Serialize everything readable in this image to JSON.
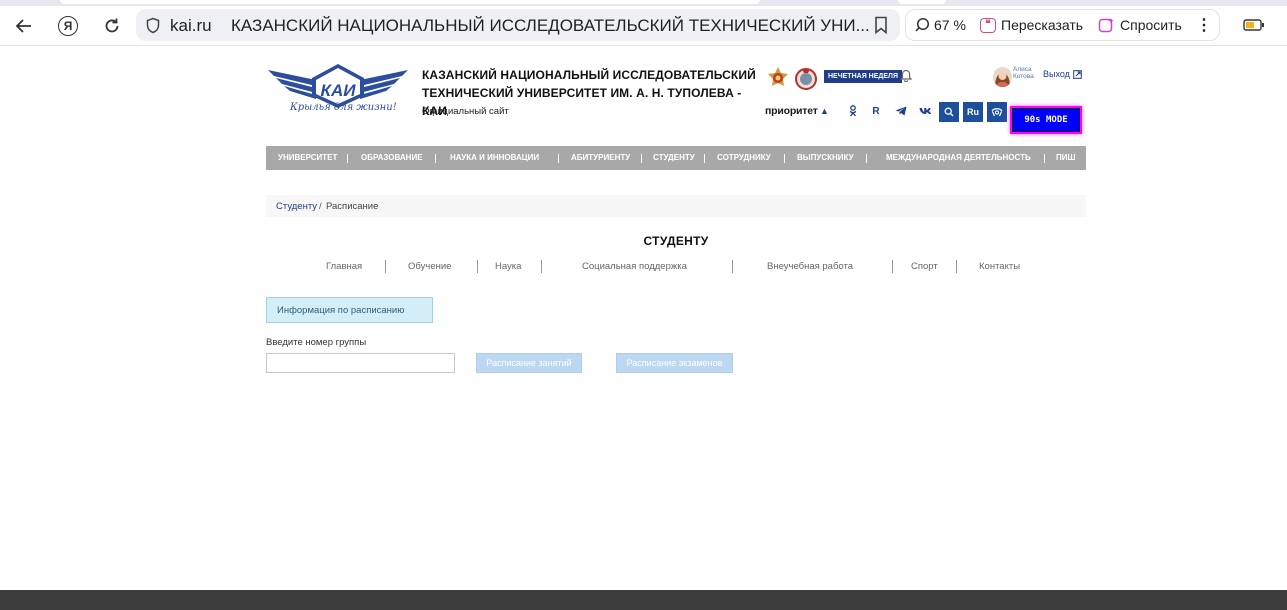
{
  "browser": {
    "domain": "kai.ru",
    "page_title": "КАЗАНСКИЙ НАЦИОНАЛЬНЫЙ ИССЛЕДОВАТЕЛЬСКИЙ ТЕХНИЧЕСКИЙ УНИ...",
    "zoom": "67 %",
    "retell_label": "Пересказать",
    "ask_label": "Спросить",
    "yandex_glyph": "Я"
  },
  "header": {
    "logo_letters": "КАИ",
    "logo_slogan": "Крылья для жизни!",
    "title_line1": "КАЗАНСКИЙ НАЦИОНАЛЬНЫЙ ИССЛЕДОВАТЕЛЬСКИЙ",
    "title_line2": "ТЕХНИЧЕСКИЙ УНИВЕРСИТЕТ ИМ. А. Н. ТУПОЛЕВА - КАИ",
    "official_site": "Официальный сайт",
    "week_badge": "НЕЧЕТНАЯ НЕДЕЛЯ",
    "user_first": "Алиса",
    "user_last": "Котова",
    "logout": "Выход",
    "priority": "приоритет",
    "lang": "Ru",
    "mode_button": "90s MODE",
    "social_r": "R"
  },
  "nav": {
    "items": [
      "УНИВЕРСИТЕТ",
      "ОБРАЗОВАНИЕ",
      "НАУКА И ИННОВАЦИИ",
      "АБИТУРИЕНТУ",
      "СТУДЕНТУ",
      "СОТРУДНИКУ",
      "ВЫПУСКНИКУ",
      "МЕЖДУНАРОДНАЯ ДЕЯТЕЛЬНОСТЬ",
      "ПИШ"
    ]
  },
  "breadcrumb": {
    "link": "Студенту",
    "separator": "/",
    "current": "Расписание"
  },
  "section": {
    "title": "СТУДЕНТУ",
    "subnav": [
      "Главная",
      "Обучение",
      "Наука",
      "Социальная поддержка",
      "Внеучебная работа",
      "Спорт",
      "Контакты"
    ]
  },
  "schedule": {
    "info": "Информация по расписанию",
    "group_label": "Введите номер группы",
    "group_value": "",
    "classes_button": "Расписание занятий",
    "exams_button": "Расписание экзаменов"
  },
  "colors": {
    "brand_blue": "#1e3e8c",
    "nav_gray": "#a8a8a8",
    "info_bg": "#d4eef7",
    "button_disabled": "#bcd7f2",
    "mode_blue": "#0000ff",
    "mode_border": "#ff00ff"
  }
}
